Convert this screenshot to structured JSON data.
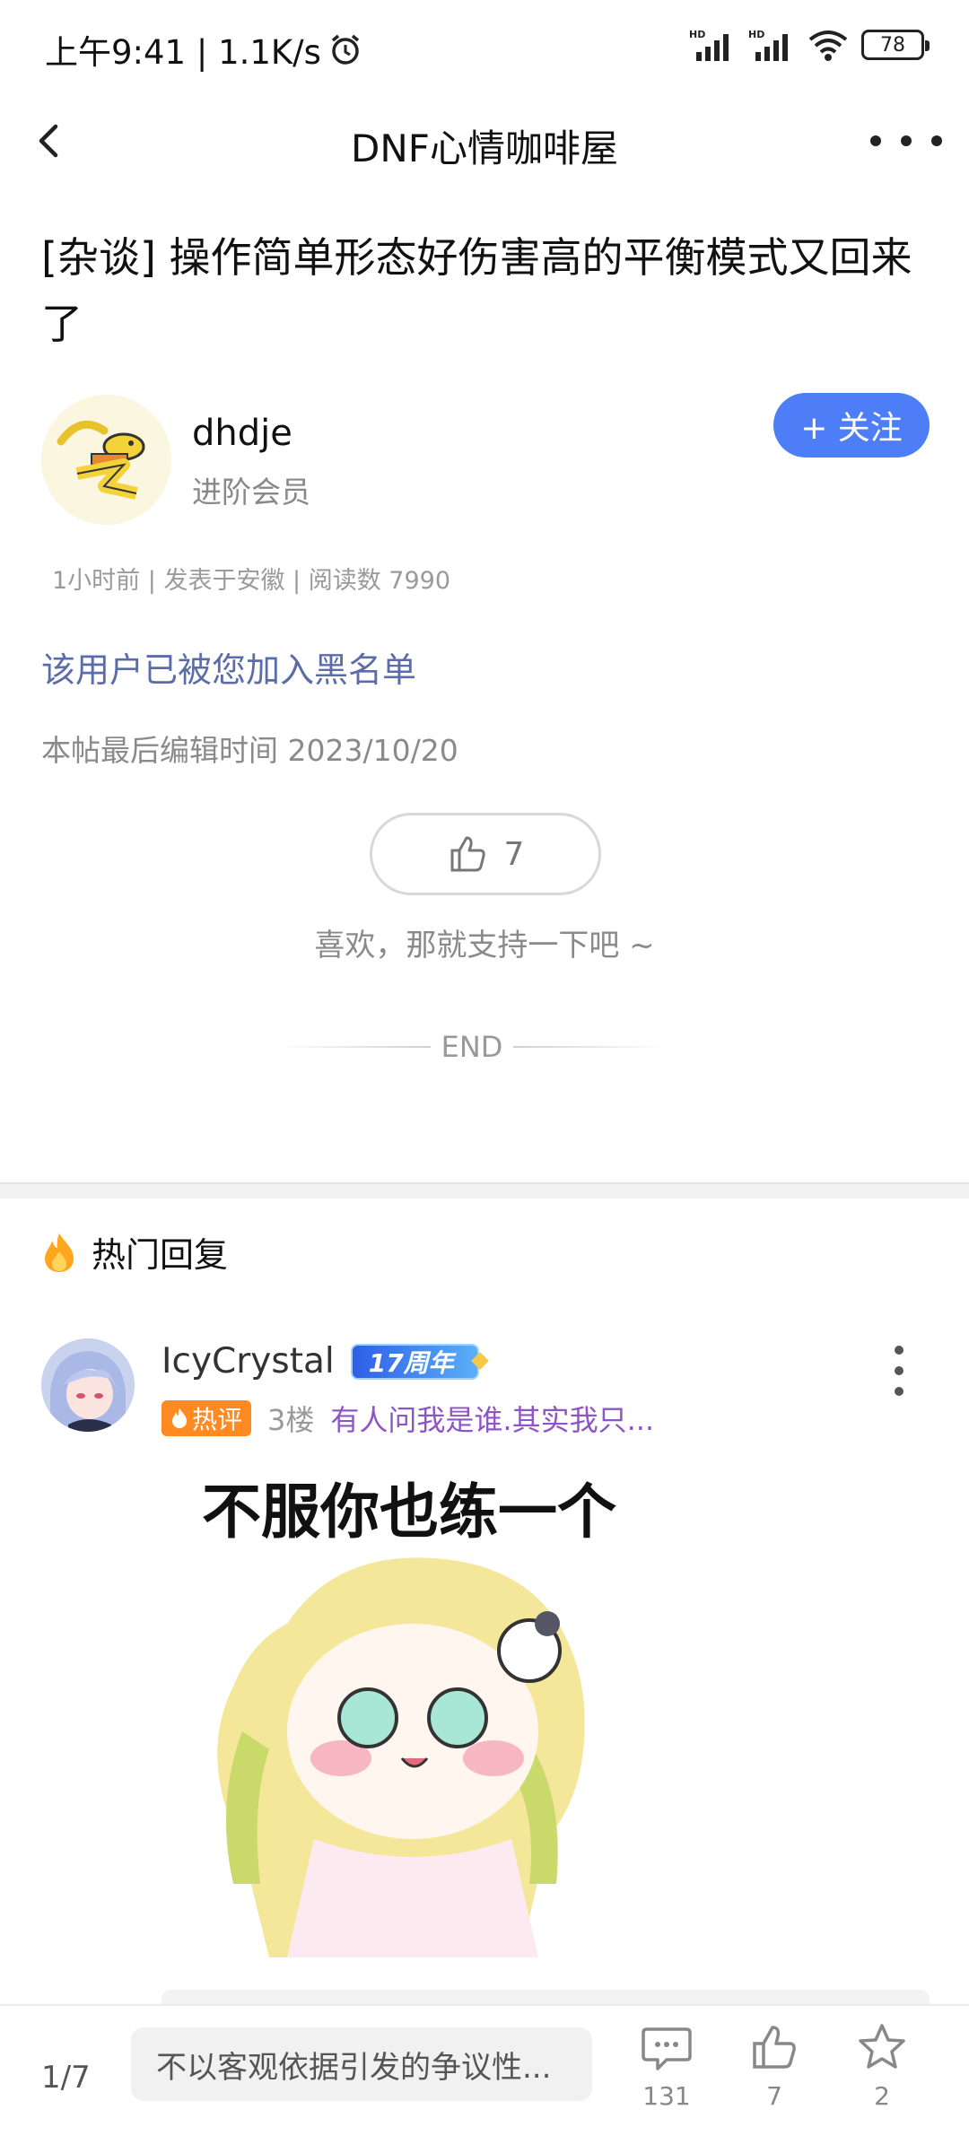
{
  "status_bar": {
    "time_speed": "上午9:41 | 1.1K/s",
    "battery": "78"
  },
  "nav": {
    "title": "DNF心情咖啡屋"
  },
  "post": {
    "title": "[杂谈] 操作简单形态好伤害高的平衡模式又回来了",
    "author": {
      "name": "dhdje",
      "level": "进阶会员",
      "follow_label": "+ 关注"
    },
    "meta": "1小时前 | 发表于安徽 | 阅读数 7990",
    "blacklist_note": "该用户已被您加入黑名单",
    "edit_time": "本帖最后编辑时间 2023/10/20",
    "like_count": "7",
    "support_text": "喜欢，那就支持一下吧 ~",
    "end_label": "END"
  },
  "hot_replies": {
    "header": "热门回复",
    "items": [
      {
        "name": "IcyCrystal",
        "badge": "17周年",
        "hot_label": "热评",
        "floor": "3楼",
        "quote": "有人问我是谁.其实我只...",
        "image_caption": "不服你也练一个"
      }
    ]
  },
  "bottom_bar": {
    "page": "1/7",
    "input_placeholder": "不以客观依据引发的争议性...",
    "comments": "131",
    "likes": "7",
    "favorites": "2"
  },
  "colors": {
    "accent_blue": "#4d7ef7",
    "hot_orange": "#ff8a22",
    "quote_purple": "#8e55c7",
    "blacklist_blue": "#5b6ca8"
  }
}
